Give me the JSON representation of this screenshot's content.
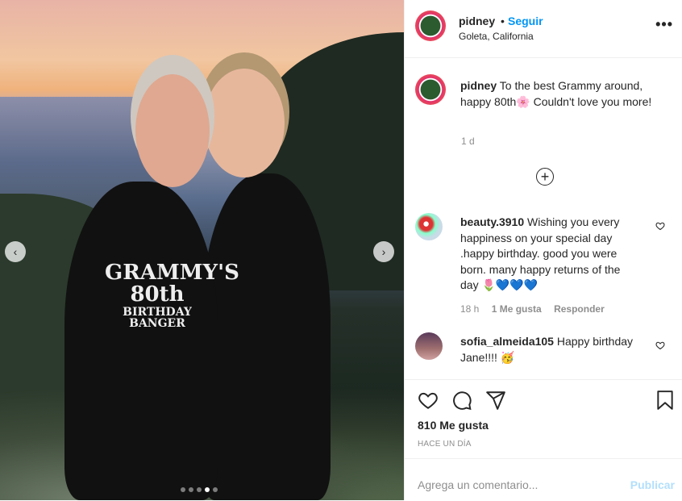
{
  "post": {
    "username": "pidney",
    "separator": "•",
    "follow_label": "Seguir",
    "location": "Goleta, California",
    "more_label": "•••",
    "caption": "To the best Grammy around, happy 80th🌸 Couldn't love you more!",
    "caption_time": "1 d",
    "load_more_label": "+",
    "shirt_text_1": "GRAMMY'S",
    "shirt_text_2": "80th",
    "shirt_text_3": "BIRTHDAY",
    "shirt_text_4": "BANGER",
    "carousel": {
      "count": 5,
      "active": 3
    },
    "prev_label": "‹",
    "next_label": "›"
  },
  "comments": [
    {
      "username": "beauty.3910",
      "text": "Wishing you every happiness on your special day .happy birthday. good you were born. many happy returns of the day 🌷💙💙💙",
      "time": "18 h",
      "likes": "1 Me gusta",
      "reply": "Responder"
    },
    {
      "username": "sofia_almeida105",
      "text": "Happy birthday Jane!!!! 🥳"
    }
  ],
  "actions": {
    "likes": "810 Me gusta",
    "ago": "HACE UN DÍA"
  },
  "comment_box": {
    "placeholder": "Agrega un comentario...",
    "publish_label": "Publicar"
  },
  "colors": {
    "accent": "#0095f6",
    "publish_disabled": "#b2dffc",
    "muted": "#8e8e8e"
  },
  "icons": [
    "heart-icon",
    "comment-icon",
    "share-icon",
    "bookmark-icon",
    "more-icon",
    "plus-circle-icon",
    "chevron-left-icon",
    "chevron-right-icon"
  ]
}
